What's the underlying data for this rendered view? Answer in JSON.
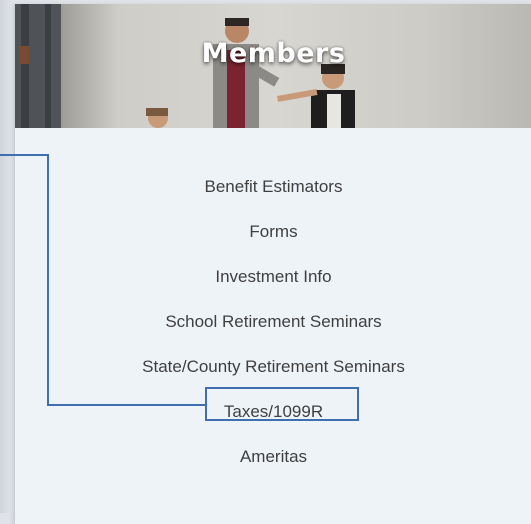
{
  "header": {
    "title": "Members"
  },
  "menu": {
    "items": [
      {
        "label": "Benefit Estimators"
      },
      {
        "label": "Forms"
      },
      {
        "label": "Investment Info"
      },
      {
        "label": "School Retirement Seminars"
      },
      {
        "label": "State/County Retirement Seminars"
      },
      {
        "label": "Taxes/1099R"
      },
      {
        "label": "Ameritas"
      }
    ]
  },
  "annotation": {
    "highlighted_item": "Taxes/1099R",
    "color": "#3f6fb0"
  },
  "colors": {
    "panel_background": "#eef3f8",
    "menu_text": "#3f3f3f"
  }
}
